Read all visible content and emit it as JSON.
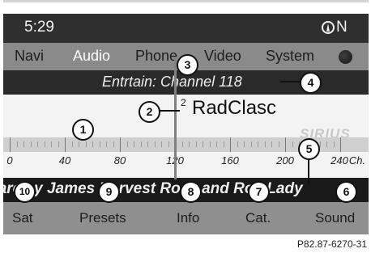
{
  "status_bar": {
    "time": "5:29",
    "compass_heading": "N",
    "compass_icon": "compass-icon"
  },
  "menu": {
    "items": [
      {
        "label": "Navi",
        "active": false
      },
      {
        "label": "Audio",
        "active": true
      },
      {
        "label": "Phone",
        "active": false
      },
      {
        "label": "Video",
        "active": false
      },
      {
        "label": "System",
        "active": false
      }
    ],
    "globe_icon": "globe-icon"
  },
  "channel_line": {
    "text": "Entrtain: Channel 118"
  },
  "station": {
    "preset_number": "2",
    "name": "RadClasc"
  },
  "band": {
    "logo_text": "SIRIUS",
    "scale_labels": [
      "0",
      "40",
      "80",
      "120",
      "160",
      "200",
      "240",
      "Ch."
    ],
    "tuned_channel": 118
  },
  "track_line": {
    "text": "Barclay James Harvest Rock and Roll Lady"
  },
  "softkeys": [
    "Sat",
    "Presets",
    "Info",
    "Cat.",
    "Sound"
  ],
  "callouts": [
    "1",
    "2",
    "3",
    "4",
    "5",
    "6",
    "7",
    "8",
    "9",
    "10"
  ],
  "caption": "P82.87-6270-31"
}
